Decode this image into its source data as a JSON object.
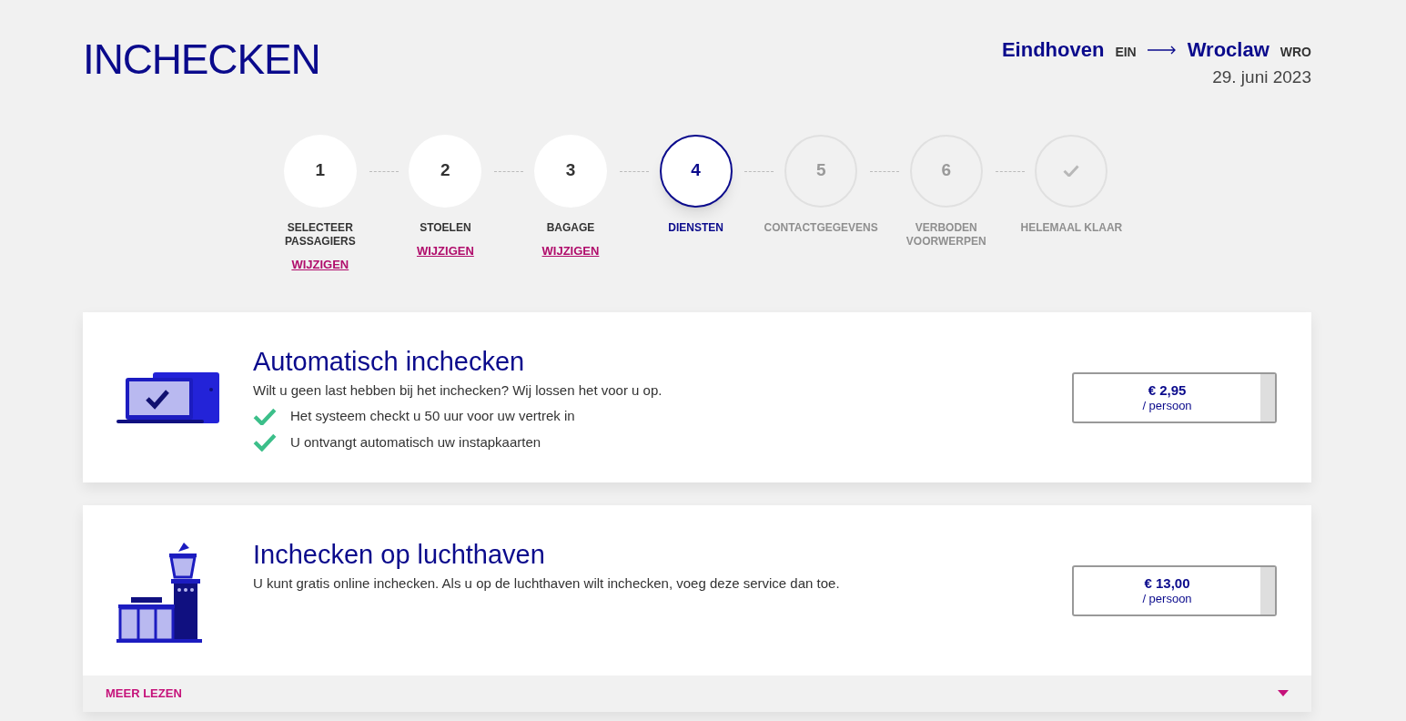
{
  "header": {
    "title": "INCHECKEN",
    "route": {
      "from_city": "Eindhoven",
      "from_code": "EIN",
      "to_city": "Wroclaw",
      "to_code": "WRO",
      "date": "29. juni 2023"
    }
  },
  "steps": [
    {
      "kind": "number",
      "number": "1",
      "label": "SELECTEER PASSAGIERS",
      "completed": true,
      "active": false,
      "link": "WIJZIGEN"
    },
    {
      "kind": "number",
      "number": "2",
      "label": "STOELEN",
      "completed": true,
      "active": false,
      "link": "WIJZIGEN"
    },
    {
      "kind": "number",
      "number": "3",
      "label": "BAGAGE",
      "completed": true,
      "active": false,
      "link": "WIJZIGEN"
    },
    {
      "kind": "number",
      "number": "4",
      "label": "DIENSTEN",
      "completed": false,
      "active": true
    },
    {
      "kind": "number",
      "number": "5",
      "label": "CONTACTGEGEVENS",
      "completed": false,
      "active": false
    },
    {
      "kind": "number",
      "number": "6",
      "label": "VERBODEN VOORWERPEN",
      "completed": false,
      "active": false
    },
    {
      "kind": "check",
      "label": "HELEMAAL KLAAR",
      "completed": false,
      "active": false
    }
  ],
  "services": [
    {
      "kind": "online",
      "title": "Automatisch inchecken",
      "description": "Wilt u geen last hebben bij het inchecken? Wij lossen het voor u op.",
      "features": [
        "Het systeem checkt u 50 uur voor uw vertrek in",
        "U ontvangt automatisch uw instapkaarten"
      ],
      "price": "€ 2,95",
      "unit": "/ persoon",
      "selected": false
    },
    {
      "kind": "airport",
      "title": "Inchecken op luchthaven",
      "description": "U kunt gratis online inchecken. Als u op de luchthaven wilt inchecken, voeg deze service dan toe.",
      "price": "€ 13,00",
      "unit": "/ persoon",
      "selected": false,
      "more": {
        "label": "MEER LEZEN",
        "expanded": false
      }
    }
  ]
}
